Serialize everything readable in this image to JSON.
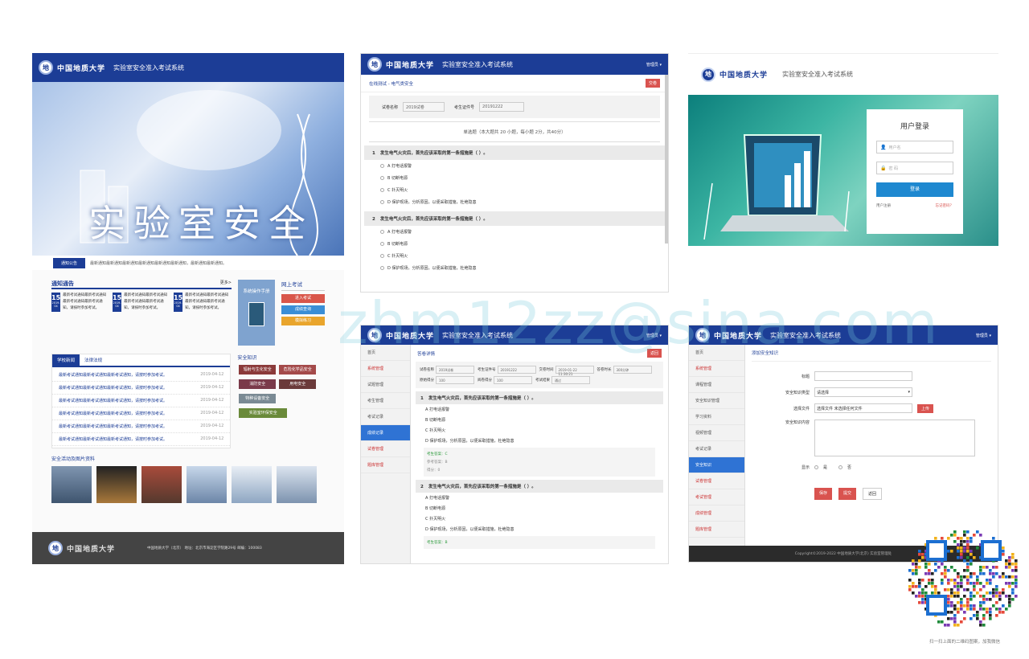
{
  "univ_name": "中国地质大学",
  "system_title": "实验室安全准入考试系统",
  "panel1": {
    "banner_text": "实验室安全",
    "marquee_label": "通知公告",
    "marquee_text": "最新通知最新通知最新通知最新通知最新通知最新通知，最新通知最新通知。",
    "notice_title": "通知通告",
    "more": "更多>",
    "notices": [
      {
        "day": "15",
        "date": "2019-04",
        "text": "最新考试通知最新考试通知最新考试通知最新考试通知，请按时参加考试。"
      },
      {
        "day": "15",
        "date": "2019-04",
        "text": "最新考试通知最新考试通知最新考试通知最新考试通知，请按时参加考试。"
      },
      {
        "day": "15",
        "date": "2019-04",
        "text": "最新考试通知最新考试通知最新考试通知最新考试通知，请按时参加考试。"
      }
    ],
    "handbook": "系统操作手册",
    "online_exam": "网上考试",
    "exam_buttons": [
      "进入考试",
      "成绩查询",
      "模拟练习"
    ],
    "tabs": [
      "学校新闻",
      "法律法规"
    ],
    "news": [
      {
        "t": "最新考试通知最新考试通知最新考试通知，请按时参加考试。",
        "d": "2019-04-12"
      },
      {
        "t": "最新考试通知最新考试通知最新考试通知，请按时参加考试。",
        "d": "2019-04-12"
      },
      {
        "t": "最新考试通知最新考试通知最新考试通知，请按时参加考试。",
        "d": "2019-04-12"
      },
      {
        "t": "最新考试通知最新考试通知最新考试通知，请按时参加考试。",
        "d": "2019-04-12"
      },
      {
        "t": "最新考试通知最新考试通知最新考试通知，请按时参加考试。",
        "d": "2019-04-12"
      },
      {
        "t": "最新考试通知最新考试通知最新考试通知，请按时参加考试。",
        "d": "2019-04-12"
      }
    ],
    "safety_title": "安全知识",
    "safety_tags": [
      "辐射与生化安全",
      "危险化学品安全",
      "消防安全",
      "用电安全",
      "特种设备安全",
      "实验室环保安全"
    ],
    "gallery_title": "安全活动及图片资料",
    "footer_text": "中国地质大学（北京） 地址：北京市海淀区学院路29号 邮编：100083"
  },
  "panel2": {
    "user": "管理员",
    "breadcrumb": "在线测试 - 电气类安全",
    "btn_submit": "交卷",
    "paper_label": "试卷名称",
    "paper_val": "2019试卷",
    "student_label": "考生证件号",
    "student_val": "20191222",
    "summary": "单选题（本大题共 20 小题，每小题 2分，共40分）",
    "questions": [
      {
        "n": "1",
        "t": "发生电气火灾后，首先应该采取的第一条措施是（ ）。",
        "opts": [
          "A 打电话报警",
          "B 切断电源",
          "C 扑灭明火",
          "D 保护现场，分析原因，以便采取措施，杜绝隐患"
        ]
      },
      {
        "n": "2",
        "t": "发生电气火灾后，首先应该采取的第一条措施是（ ）。",
        "opts": [
          "A 打电话报警",
          "B 切断电源",
          "C 扑灭明火",
          "D 保护现场，分析原因，以便采取措施，杜绝隐患"
        ]
      }
    ]
  },
  "panel3": {
    "login_title": "用户登录",
    "username_ph": "用户名",
    "password_ph": "密 码",
    "login_btn": "登录",
    "register": "用户注册",
    "forgot": "忘记密码？"
  },
  "panel4": {
    "user": "管理员",
    "title": "答卷详情",
    "back": "返回",
    "side": [
      "首页",
      "系统管理",
      "试题管理",
      "考生管理",
      "考试记录",
      "成绩记录",
      "试卷管理",
      "题库管理"
    ],
    "side_active": 5,
    "info": [
      [
        "试卷名称",
        "2019试卷"
      ],
      [
        "考生证件号",
        "20191222"
      ],
      [
        "交卷时间",
        "2019-01-22 11:30:21"
      ],
      [
        "答卷时长",
        "300分钟"
      ],
      [
        "原始得分",
        "100"
      ],
      [
        "阅卷得分",
        "100"
      ],
      [
        "考试结果",
        "通过"
      ]
    ],
    "questions": [
      {
        "n": "1",
        "t": "发生电气火灾后，首先应该采取的第一条措施是（ ）。",
        "opts": [
          "A 打电话报警",
          "B 切断电源",
          "C 扑灭明火",
          "D 保护现场，分析原因，以便采取措施，杜绝隐患"
        ],
        "ans": "考生答案：C",
        "std": "参考答案：B",
        "score": "得分：0"
      },
      {
        "n": "2",
        "t": "发生电气火灾后，首先应该采取的第一条措施是（ ）。",
        "opts": [
          "A 打电话报警",
          "B 切断电源",
          "C 扑灭明火",
          "D 保护现场，分析原因，以便采取措施，杜绝隐患"
        ],
        "ans": "考生答案：B",
        "std": "",
        "score": ""
      }
    ]
  },
  "panel5": {
    "user": "管理员",
    "title": "添加安全知识",
    "side": [
      "首页",
      "系统管理",
      "课程管理",
      "安全知识管理",
      "学习资料",
      "视频管理",
      "考试记录",
      "安全知识",
      "试卷管理",
      "考试管理",
      "成绩管理",
      "题库管理"
    ],
    "side_active": 7,
    "f_title": "标题",
    "f_type": "安全知识类型",
    "f_type_val": "请选择",
    "f_file": "选择文件",
    "f_file_val": "选择文件  未选择任何文件",
    "upload": "上传",
    "f_content": "安全知识内容",
    "f_show": "显示",
    "yes": "是",
    "no": "否",
    "btn_save": "保存",
    "btn_submit": "提交",
    "btn_back": "返回",
    "copyright": "Copyright©2019-2022 中国地质大学(北京) 实验室管理处"
  },
  "watermark": "zhm12zz@sina.com",
  "qr_caption": "扫一扫上面的二维码图案，加我微信"
}
